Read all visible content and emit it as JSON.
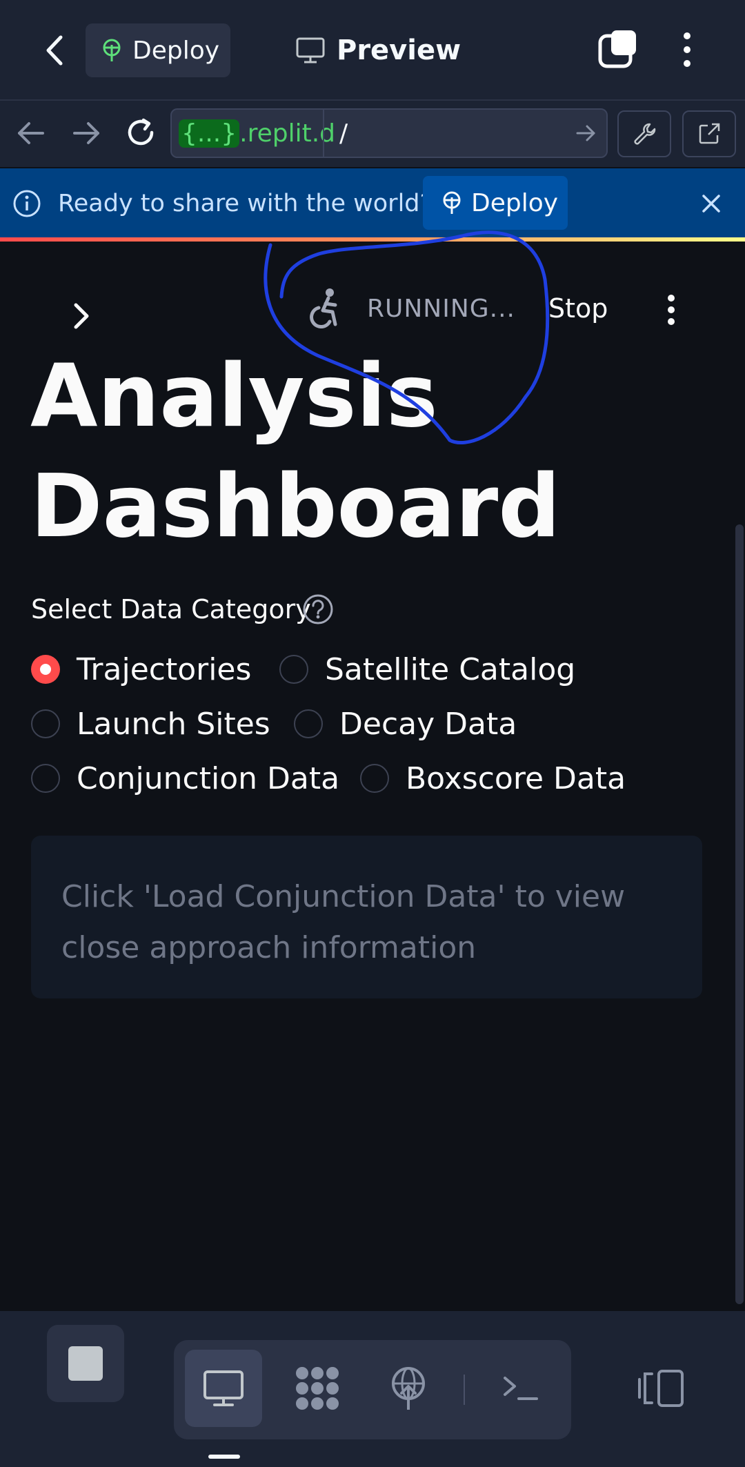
{
  "topbar": {
    "deploy_label": "Deploy",
    "preview_label": "Preview"
  },
  "urlbar": {
    "domain_brace": "{...}",
    "domain_rest": ".replit.d",
    "path": "/"
  },
  "banner": {
    "message": "Ready to share with the world?",
    "deploy_label": "Deploy"
  },
  "app_header": {
    "status_text": "RUNNING...",
    "stop_label": "Stop"
  },
  "main": {
    "title_line1": "Analysis",
    "title_line2": "Dashboard",
    "category_label": "Select Data Category",
    "radio_options": [
      {
        "label": "Trajectories",
        "checked": true
      },
      {
        "label": "Satellite Catalog",
        "checked": false
      },
      {
        "label": "Launch Sites",
        "checked": false
      },
      {
        "label": "Decay Data",
        "checked": false
      },
      {
        "label": "Conjunction Data",
        "checked": false
      },
      {
        "label": "Boxscore Data",
        "checked": false
      }
    ],
    "info_message": "Click 'Load Conjunction Data' to view close approach information"
  },
  "colors": {
    "accent": "#ff4b4b",
    "banner_bg": "#004182",
    "annotation": "#1f3fe0",
    "url_green": "#4fd16a"
  },
  "icons": [
    "chevron-left-icon",
    "deploy-icon",
    "monitor-icon",
    "tabs-icon",
    "kebab-icon",
    "arrow-left-icon",
    "arrow-right-icon",
    "reload-icon",
    "wrench-icon",
    "external-link-icon",
    "info-icon",
    "close-icon",
    "chevron-right-icon",
    "running-icon",
    "help-icon",
    "stop-icon",
    "workflows-icon",
    "shell-icon",
    "layout-icon"
  ]
}
